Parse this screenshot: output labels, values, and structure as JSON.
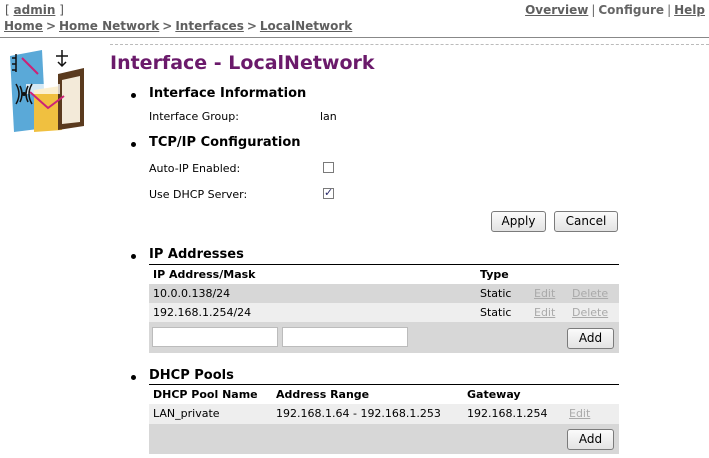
{
  "user": {
    "bracket_open": "[",
    "name": "admin",
    "bracket_close": "]"
  },
  "breadcrumb": [
    "Home",
    "Home Network",
    "Interfaces",
    "LocalNetwork"
  ],
  "breadcrumb_sep": ">",
  "nav": {
    "overview": "Overview",
    "configure": "Configure",
    "help": "Help",
    "sep": "|"
  },
  "page_title": "Interface - LocalNetwork",
  "interface_info": {
    "heading": "Interface Information",
    "group_label": "Interface Group:",
    "group_value": "lan"
  },
  "tcpip": {
    "heading": "TCP/IP Configuration",
    "auto_ip_label": "Auto-IP Enabled:",
    "auto_ip_checked": false,
    "dhcp_server_label": "Use DHCP Server:",
    "dhcp_server_checked": true,
    "apply_label": "Apply",
    "cancel_label": "Cancel"
  },
  "ip_addresses": {
    "heading": "IP Addresses",
    "columns": [
      "IP Address/Mask",
      "Type"
    ],
    "rows": [
      {
        "address": "10.0.0.138/24",
        "type": "Static",
        "edit": "Edit",
        "delete": "Delete"
      },
      {
        "address": "192.168.1.254/24",
        "type": "Static",
        "edit": "Edit",
        "delete": "Delete"
      }
    ],
    "new_address_value": "",
    "new_mask_value": "",
    "add_label": "Add"
  },
  "dhcp_pools": {
    "heading": "DHCP Pools",
    "columns": [
      "DHCP Pool Name",
      "Address Range",
      "Gateway"
    ],
    "rows": [
      {
        "name": "LAN_private",
        "range": "192.168.1.64 - 192.168.1.253",
        "gateway": "192.168.1.254",
        "edit": "Edit"
      }
    ],
    "add_label": "Add"
  },
  "colors": {
    "title": "#6b1a6b",
    "row_shade": "#d7d7d7",
    "row_light": "#eeeeee",
    "disabled_link": "#aaaaaa"
  },
  "icons": [
    "network-interface-logo-icon",
    "checkbox-checked-icon"
  ]
}
